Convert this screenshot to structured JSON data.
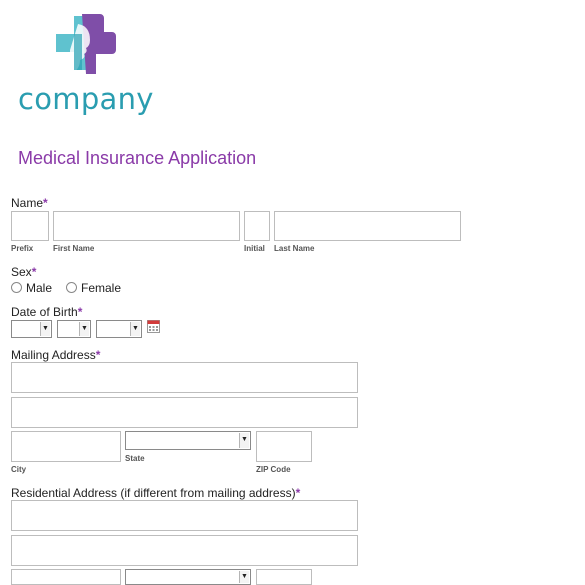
{
  "brand": {
    "name": "company"
  },
  "form": {
    "title": "Medical Insurance Application",
    "name": {
      "label": "Name",
      "required": "*",
      "sublabels": {
        "prefix": "Prefix",
        "first": "First Name",
        "initial": "Initial",
        "last": "Last Name"
      }
    },
    "sex": {
      "label": "Sex",
      "required": "*",
      "options": [
        "Male",
        "Female"
      ]
    },
    "dob": {
      "label": "Date of Birth",
      "required": "*"
    },
    "mailing": {
      "label": "Mailing Address",
      "required": "*",
      "sublabels": {
        "city": "City",
        "state": "State",
        "zip": "ZIP Code"
      }
    },
    "residential": {
      "label": "Residential Address (if different from mailing address)",
      "required": "*"
    }
  },
  "colors": {
    "accent": "#8a3aa8",
    "brand_teal": "#2a9db0"
  },
  "icons": {
    "calendar": "calendar-icon",
    "dropdown": "chevron-down-icon"
  }
}
